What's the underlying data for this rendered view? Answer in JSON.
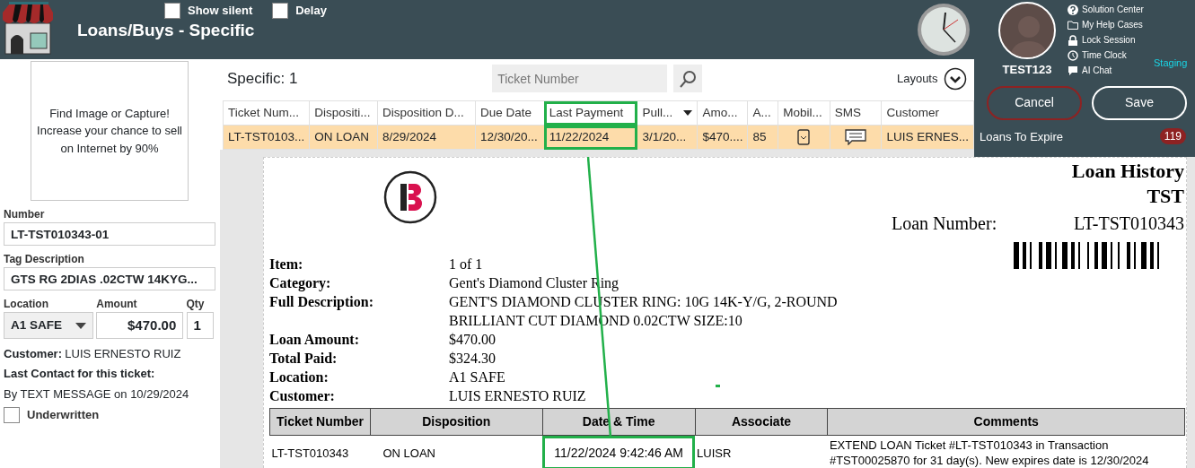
{
  "header": {
    "title": "Loans/Buys - Specific",
    "options": [
      {
        "label": "Show silent",
        "checked": false
      },
      {
        "label": "Delay",
        "checked": false
      }
    ]
  },
  "user": {
    "name": "TEST123",
    "environment": "Staging",
    "links": [
      {
        "kind": "help",
        "label": "Solution Center"
      },
      {
        "kind": "folder",
        "label": "My Help Cases"
      },
      {
        "kind": "lock",
        "label": "Lock Session"
      },
      {
        "kind": "clock",
        "label": "Time Clock"
      },
      {
        "kind": "chat",
        "label": "AI Chat"
      }
    ]
  },
  "actions": {
    "cancel": "Cancel",
    "save": "Save"
  },
  "queue": {
    "label": "Loans To Expire",
    "count": "119"
  },
  "item_panel": {
    "image_prompt": "Find Image or Capture! Increase your chance to sell on Internet by 90%",
    "number_label": "Number",
    "number": "LT-TST010343-01",
    "tag_label": "Tag Description",
    "tag": "GTS RG 2DIAS .02CTW 14KYG...",
    "location_label": "Location",
    "location": "A1 SAFE",
    "amount_label": "Amount",
    "amount": "$470.00",
    "qty_label": "Qty",
    "qty": "1",
    "customer_label": "Customer:",
    "customer": "LUIS ERNESTO RUIZ",
    "contact_label": "Last Contact for this ticket:",
    "contact": "By TEXT MESSAGE on 10/29/2024",
    "underwritten": {
      "label": "Underwritten",
      "checked": false
    }
  },
  "results": {
    "title": "Specific: 1",
    "search": {
      "placeholder": "Ticket Number"
    },
    "layouts": "Layouts",
    "columns": [
      {
        "label": "Ticket Num...",
        "highlighted": false
      },
      {
        "label": "Dispositi...",
        "highlighted": false
      },
      {
        "label": "Disposition D...",
        "highlighted": false
      },
      {
        "label": "Due Date",
        "highlighted": false
      },
      {
        "label": "Last Payment",
        "highlighted": true
      },
      {
        "label": "Pull...",
        "highlighted": false,
        "sorted": true
      },
      {
        "label": "Amo...",
        "highlighted": false
      },
      {
        "label": "A...",
        "highlighted": false
      },
      {
        "label": "Mobil...",
        "highlighted": false
      },
      {
        "label": "SMS",
        "highlighted": false
      },
      {
        "label": "Customer",
        "highlighted": false
      }
    ],
    "rows": [
      {
        "selected": true,
        "cells": [
          {
            "kind": "text",
            "text": "LT-TST0103..."
          },
          {
            "kind": "text",
            "text": "ON LOAN"
          },
          {
            "kind": "text",
            "text": "8/29/2024"
          },
          {
            "kind": "text",
            "text": "12/30/20..."
          },
          {
            "kind": "text",
            "text": "11/22/2024"
          },
          {
            "kind": "text",
            "text": "3/1/20..."
          },
          {
            "kind": "text",
            "text": "$470...."
          },
          {
            "kind": "text",
            "text": "85"
          },
          {
            "kind": "phone"
          },
          {
            "kind": "chat"
          },
          {
            "kind": "text",
            "text": "LUIS ERNES..."
          }
        ]
      }
    ]
  },
  "report": {
    "title": "Loan History",
    "store": "TST",
    "loan_number_label": "Loan Number:",
    "loan_number": "LT-TST010343",
    "fields": [
      {
        "label": "Item:",
        "lines": [
          "1 of 1"
        ]
      },
      {
        "label": "Category:",
        "lines": [
          "Gent's Diamond Cluster Ring"
        ]
      },
      {
        "label": "Full Description:",
        "lines": [
          "GENT'S DIAMOND CLUSTER RING: 10G 14K-Y/G, 2-ROUND",
          "BRILLIANT CUT DIAMOND 0.02CTW SIZE:10"
        ]
      },
      {
        "label": "Loan Amount:",
        "lines": [
          "$470.00"
        ]
      },
      {
        "label": "Total Paid:",
        "lines": [
          "$324.30"
        ]
      },
      {
        "label": "Location:",
        "lines": [
          "A1 SAFE"
        ]
      },
      {
        "label": "Customer:",
        "lines": [
          "LUIS ERNESTO RUIZ"
        ]
      }
    ],
    "history": {
      "columns": [
        "Ticket Number",
        "Disposition",
        "Date & Time",
        "Associate",
        "Comments"
      ],
      "rows": [
        {
          "cells": [
            {
              "text": "LT-TST010343",
              "highlighted": false
            },
            {
              "text": "ON LOAN",
              "highlighted": false
            },
            {
              "text": "11/22/2024 9:42:46 AM",
              "highlighted": true
            },
            {
              "text": "LUISR",
              "highlighted": false
            },
            {
              "text": "EXTEND LOAN Ticket #LT-TST010343 in Transaction #TST00025870 for 31 day(s). New expires date is 12/30/2024",
              "highlighted": false
            }
          ]
        }
      ]
    }
  },
  "annotation_line": true
}
